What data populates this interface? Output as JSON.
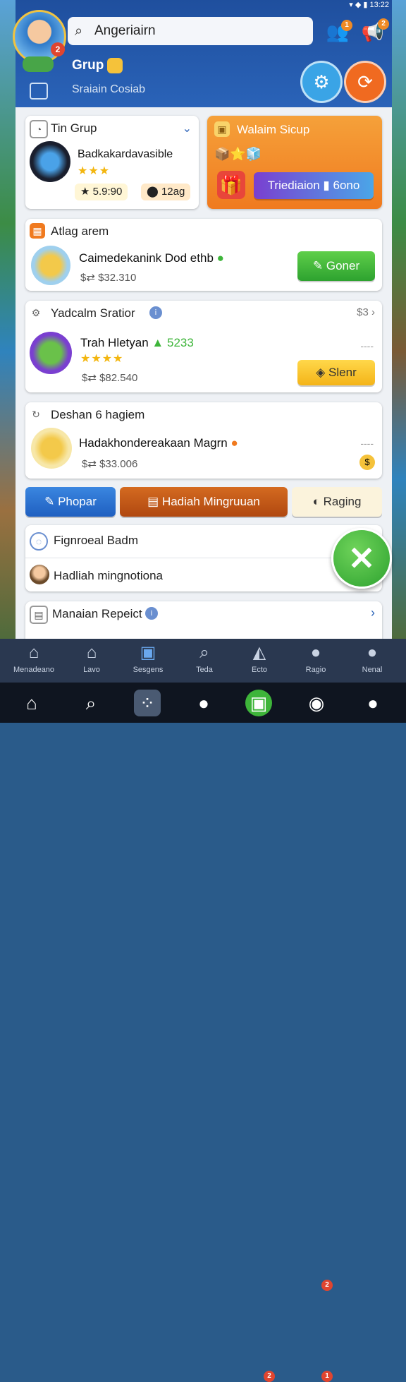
{
  "status": {
    "time": "13:22"
  },
  "header": {
    "search_text": "Angeriairn",
    "avatar_badge": "2",
    "notif_badge_1": "1",
    "notif_badge_2": "2",
    "grup_title": "Grup",
    "grup_sub": "Sraiain Cosiab"
  },
  "tin_grup": {
    "title": "Tin Grup",
    "item_name": "Badkakardavasible",
    "stars": "★★★",
    "coins": "5.9:90",
    "points": "12ag"
  },
  "promo": {
    "title": "Walaim Sicup",
    "button": "Triediaion",
    "value": "6ono"
  },
  "card_alag": {
    "title": "Atlag arem",
    "item_name": "Caimedekanink Dod ethb",
    "price": "$32.310",
    "button": "Goner"
  },
  "card_yad": {
    "title": "Yadcalm Sratior",
    "count": "3",
    "item_name": "Trah Hletyan",
    "highlight": "5233",
    "stars": "★★★★",
    "price": "$82.540",
    "button": "Slenr",
    "dash": "----"
  },
  "card_deshan": {
    "title": "Deshan 6 hagiem",
    "item_name": "Hadakhondereakaan Magrn",
    "price": "$33.006",
    "dash": "----"
  },
  "tabs": {
    "phopar": "Phopar",
    "hadiah": "Hadiah Mingruuan",
    "raging": "Raging"
  },
  "list": {
    "row1": "Fignroeal Badm",
    "row2": "Hadliah mingnotiona"
  },
  "card_manalan": {
    "title": "Manaian Repeict"
  },
  "bottom_nav": [
    {
      "label": "Menadeano",
      "icon": "home-icon"
    },
    {
      "label": "Lavo",
      "icon": "house-icon"
    },
    {
      "label": "Sesgens",
      "icon": "phone-icon"
    },
    {
      "label": "Teda",
      "icon": "search-icon"
    },
    {
      "label": "Ecto",
      "icon": "shirt-icon"
    },
    {
      "label": "Ragio",
      "icon": "chat-icon"
    },
    {
      "label": "Nenal",
      "icon": "person-icon"
    }
  ],
  "nav_badges": {
    "ragio": "2",
    "sys_game": "2",
    "sys_chat": "1"
  },
  "colors": {
    "header": "#1f4f9e",
    "accent_orange": "#f07a1f",
    "accent_green": "#3eb53a",
    "accent_purple": "#7a3fd0"
  }
}
